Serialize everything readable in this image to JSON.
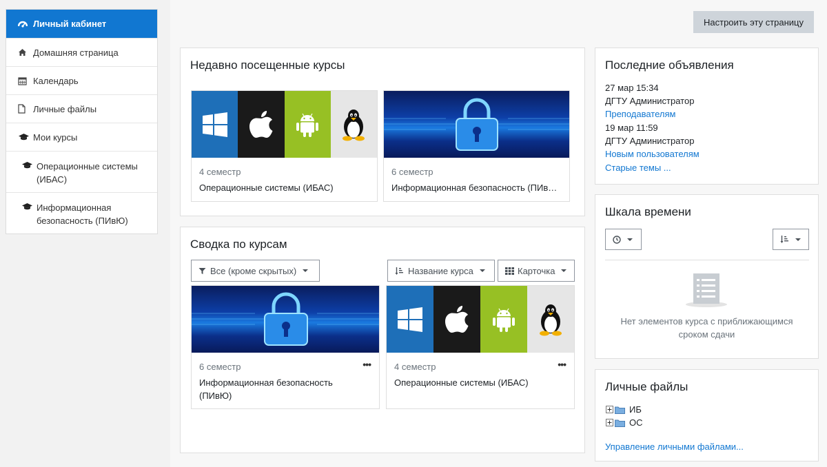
{
  "sidebar": {
    "items": [
      {
        "label": "Личный кабинет",
        "icon": "dashboard-icon"
      },
      {
        "label": "Домашняя страница",
        "icon": "home-icon"
      },
      {
        "label": "Календарь",
        "icon": "calendar-icon"
      },
      {
        "label": "Личные файлы",
        "icon": "file-icon"
      },
      {
        "label": "Мои курсы",
        "icon": "graduation-cap-icon"
      },
      {
        "label": "Операционные системы (ИБАС)",
        "icon": "graduation-cap-icon"
      },
      {
        "label": "Информационная безопасность (ПИвЮ)",
        "icon": "graduation-cap-icon"
      }
    ]
  },
  "header": {
    "customize_label": "Настроить эту страницу"
  },
  "recent": {
    "title": "Недавно посещенные курсы",
    "courses": [
      {
        "semester": "4 семестр",
        "name": "Операционные системы (ИБАС)"
      },
      {
        "semester": "6 семестр",
        "name": "Информационная безопасность (ПИв…"
      }
    ]
  },
  "overview": {
    "title": "Сводка по курсам",
    "filter_label": "Все (кроме скрытых)",
    "sort_label": "Название курса",
    "view_label": "Карточка",
    "courses": [
      {
        "semester": "6 семестр",
        "name_line1": "Информационная безопасность",
        "name_line2": "(ПИвЮ)"
      },
      {
        "semester": "4 семестр",
        "name_line1": "Операционные системы (ИБАС)",
        "name_line2": ""
      }
    ],
    "more_label": "•••"
  },
  "announcements": {
    "title": "Последние объявления",
    "items": [
      {
        "date": "27 мар 15:34",
        "author": "ДГТУ Администратор",
        "topic": "Преподавателям"
      },
      {
        "date": "19 мар 11:59",
        "author": "ДГТУ Администратор",
        "topic": "Новым пользователям"
      }
    ],
    "older_link": "Старые темы ..."
  },
  "timeline": {
    "title": "Шкала времени",
    "empty_line1": "Нет элементов курса с приближающимся",
    "empty_line2": "сроком сдачи"
  },
  "private_files": {
    "title": "Личные файлы",
    "folders": [
      "ИБ",
      "ОС"
    ],
    "manage_link": "Управление личными файлами..."
  },
  "colors": {
    "accent": "#1177d1",
    "windows": "#1e6fb8",
    "apple": "#1a1a1a",
    "android": "#97c024",
    "linux": "#e6e6e6"
  }
}
